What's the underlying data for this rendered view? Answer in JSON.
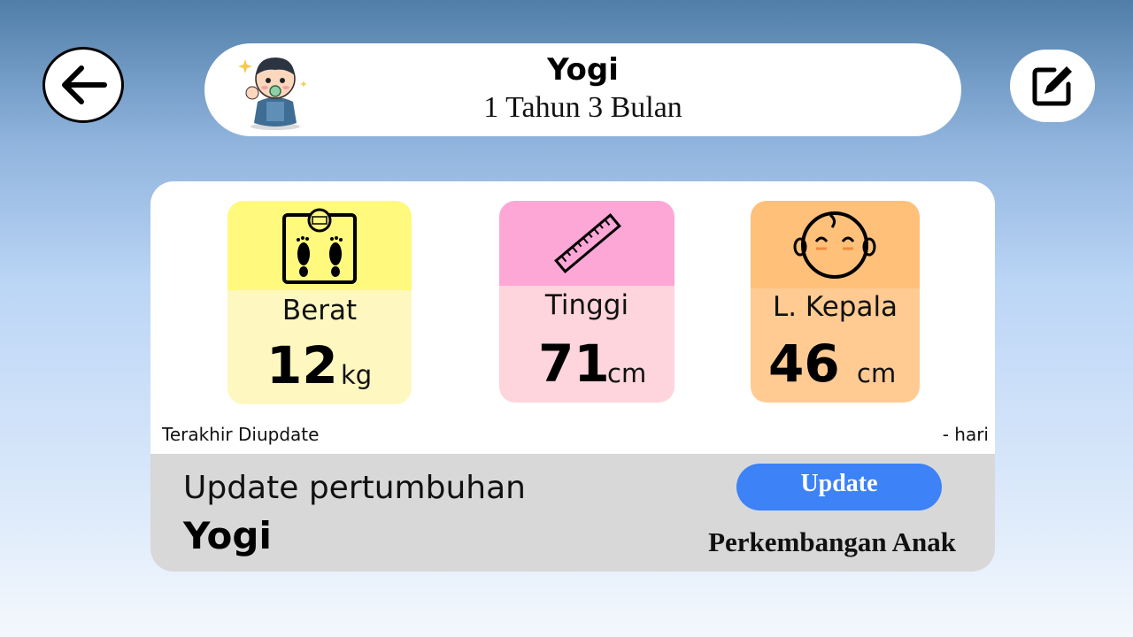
{
  "header": {
    "name": "Yogi",
    "age": "1 Tahun 3 Bulan"
  },
  "icons": {
    "back": "arrow-left-icon",
    "edit": "edit-icon",
    "avatar": "baby-avatar-icon"
  },
  "metrics": [
    {
      "label": "Berat",
      "value": "12",
      "unit": "kg",
      "icon": "scale-icon",
      "top_color": "#fff97e",
      "bottom_color": "#fef8c0"
    },
    {
      "label": "Tinggi",
      "value": "71",
      "unit": "cm",
      "icon": "ruler-icon",
      "top_color": "#fda7d6",
      "bottom_color": "#fed5dd"
    },
    {
      "label": "L. Kepala",
      "value": "46",
      "unit": "cm",
      "icon": "baby-head-icon",
      "top_color": "#ffc07a",
      "bottom_color": "#ffcb92"
    }
  ],
  "last_update": {
    "label": "Terakhir Diupdate",
    "value": "- hari"
  },
  "footer": {
    "title": "Update pertumbuhan",
    "child_name": "Yogi",
    "update_label": "Update",
    "development_label": "Perkembangan Anak"
  },
  "colors": {
    "update_button": "#3d82f6",
    "footer_bg": "#d8d8d8"
  }
}
